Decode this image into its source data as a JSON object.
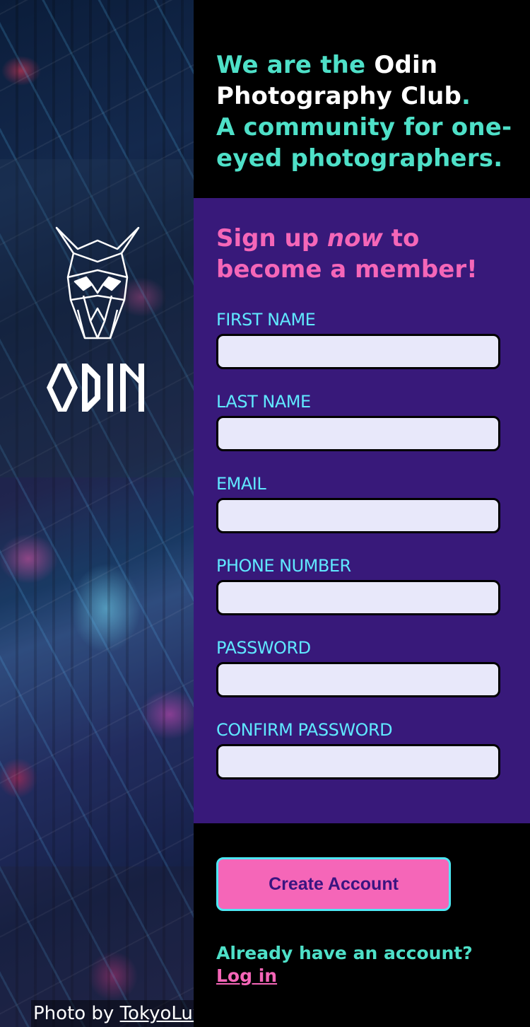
{
  "sidebar": {
    "brand": "ODIN",
    "credit_prefix": "Photo by",
    "credit_link": "TokyoLuv"
  },
  "hero": {
    "part1": "We are the ",
    "part2": "Odin Photography Club",
    "part3": ".",
    "line2": "A community for one-eyed photographers."
  },
  "form": {
    "title_before": "Sign up ",
    "title_em": "now",
    "title_after": " to become a member!",
    "fields": [
      {
        "label": "FIRST NAME",
        "value": ""
      },
      {
        "label": "LAST NAME",
        "value": ""
      },
      {
        "label": "EMAIL",
        "value": ""
      },
      {
        "label": "PHONE NUMBER",
        "value": ""
      },
      {
        "label": "PASSWORD",
        "value": ""
      },
      {
        "label": "CONFIRM PASSWORD",
        "value": ""
      }
    ]
  },
  "actions": {
    "create_label": "Create Account",
    "already_text": "Already have an account?",
    "login_label": "Log in"
  },
  "colors": {
    "teal": "#4ee0c8",
    "pink": "#f566b8",
    "purple": "#38197a",
    "cyan": "#60e8ff"
  }
}
